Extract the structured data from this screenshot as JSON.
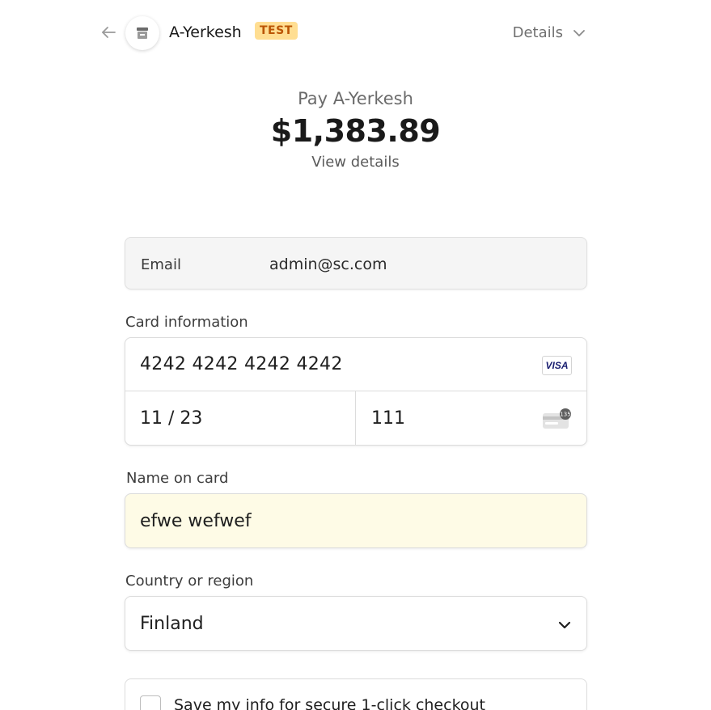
{
  "header": {
    "merchant_name": "A-Yerkesh",
    "test_badge": "TEST",
    "details_label": "Details"
  },
  "summary": {
    "pay_label": "Pay A-Yerkesh",
    "amount": "$1,383.89",
    "view_details": "View details"
  },
  "email": {
    "label": "Email",
    "value": "admin@sc.com"
  },
  "card": {
    "section_label": "Card information",
    "number": "4242 4242 4242 4242",
    "brand": "VISA",
    "expiry": "11 / 23",
    "cvc": "111",
    "cvc_hint": "135"
  },
  "name_on_card": {
    "label": "Name on card",
    "value": "efwe wefwef"
  },
  "country": {
    "label": "Country or region",
    "value": "Finland"
  },
  "save_info": {
    "label": "Save my info for secure 1-click checkout"
  },
  "icons": {
    "back": "arrow-left-icon",
    "store": "store-icon",
    "details_chevron": "chevron-down-icon",
    "country_chevron": "chevron-down-icon",
    "cvc": "cvc-card-icon"
  },
  "colors": {
    "test_badge_bg": "#ffde92",
    "test_badge_text": "#bb5504",
    "autofill_bg": "#fefbe6",
    "email_bg": "#f5f5f5",
    "visa_blue": "#1a1f71"
  }
}
